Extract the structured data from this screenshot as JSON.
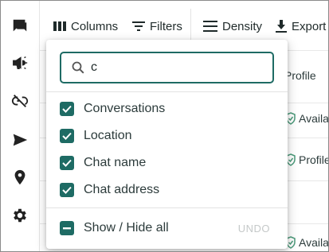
{
  "toolbar": {
    "columns_label": "Columns",
    "filters_label": "Filters",
    "density_label": "Density",
    "export_label": "Export"
  },
  "table": {
    "rows": [
      {
        "value": "Profile"
      },
      {
        "value": "Availa"
      },
      {
        "value": "Profile"
      },
      {
        "value": "Availa"
      }
    ]
  },
  "column_picker": {
    "search_value": "c",
    "options": [
      {
        "label": "Conversations",
        "checked": true
      },
      {
        "label": "Location",
        "checked": true
      },
      {
        "label": "Chat name",
        "checked": true
      },
      {
        "label": "Chat address",
        "checked": true
      }
    ],
    "show_hide_all_label": "Show / Hide all",
    "undo_label": "UNDO"
  },
  "colors": {
    "accent": "#1e6b64",
    "text": "#1f2a2a",
    "muted": "#c5c9c9"
  },
  "icons": {
    "rail": [
      "chat-icon",
      "megaphone-icon",
      "link-off-icon",
      "send-icon",
      "location-pin-icon",
      "gear-icon"
    ]
  }
}
